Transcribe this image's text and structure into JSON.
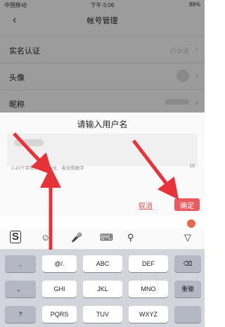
{
  "status_bar": {
    "carrier": "中国移动",
    "time": "下午 5:06",
    "battery": "89%"
  },
  "nav": {
    "title": "帐号管理",
    "back_icon": "chevron-left-icon"
  },
  "rows": [
    {
      "label": "实名认证",
      "value": "已认证"
    },
    {
      "label": "头像",
      "value": ""
    },
    {
      "label": "昵称",
      "value": ""
    }
  ],
  "dialog": {
    "title": "请输入用户名",
    "hint": "2-20个字符，支持中文、英文和数字",
    "count": "16",
    "cancel_label": "取消",
    "ok_label": "确定"
  },
  "keyboard": {
    "toolbar": [
      "sogou-logo-icon",
      "emoji-icon",
      "mic-icon",
      "keyboard-icon",
      "search-icon",
      "collapse-icon"
    ],
    "rows": [
      [
        ",",
        "@/.",
        "ABC",
        "DEF",
        "⌫"
      ],
      [
        "。",
        "GHI",
        "JKL",
        "MNO",
        "重输"
      ],
      [
        "?",
        "PQRS",
        "TUV",
        "WXYZ",
        ""
      ]
    ]
  }
}
